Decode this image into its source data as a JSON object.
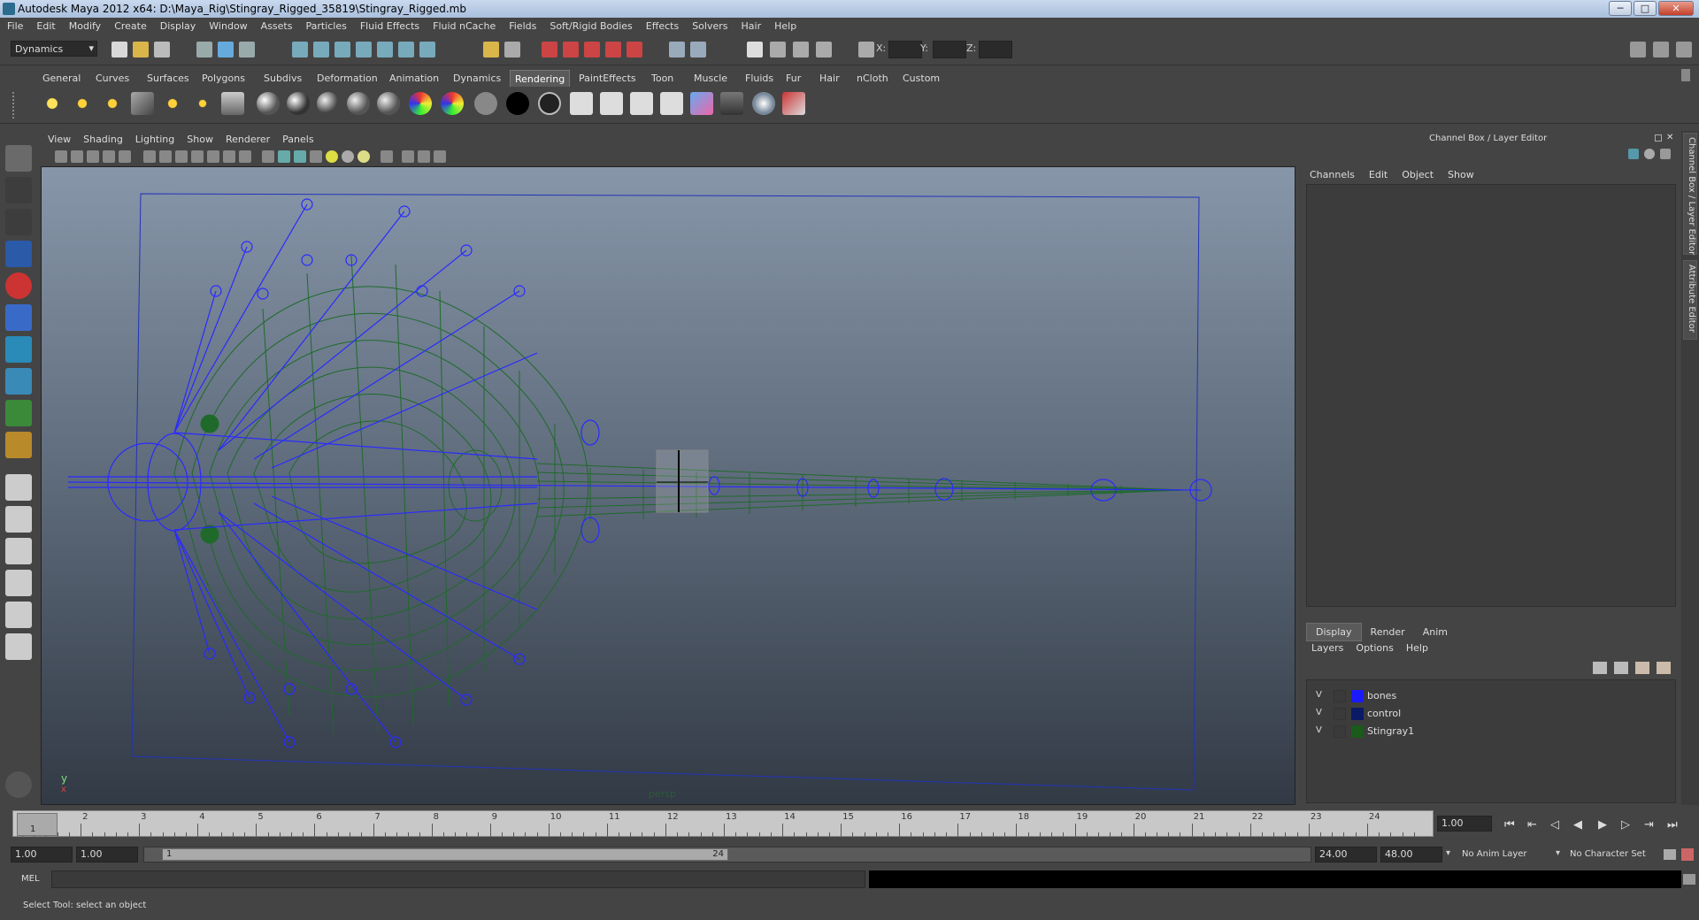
{
  "window": {
    "title": "Autodesk Maya 2012 x64: D:\\Maya_Rig\\Stingray_Rigged_35819\\Stingray_Rigged.mb",
    "min_label": "─",
    "max_label": "□",
    "close_label": "✕"
  },
  "menubar": [
    "File",
    "Edit",
    "Modify",
    "Create",
    "Display",
    "Window",
    "Assets",
    "Particles",
    "Fluid Effects",
    "Fluid nCache",
    "Fields",
    "Soft/Rigid Bodies",
    "Effects",
    "Solvers",
    "Hair",
    "Help"
  ],
  "status_line": {
    "mode": "Dynamics",
    "x_label": "X:",
    "y_label": "Y:",
    "z_label": "Z:"
  },
  "shelf_tabs": [
    "General",
    "Curves",
    "Surfaces",
    "Polygons",
    "Subdivs",
    "Deformation",
    "Animation",
    "Dynamics",
    "Rendering",
    "PaintEffects",
    "Toon",
    "Muscle",
    "Fluids",
    "Fur",
    "Hair",
    "nCloth",
    "Custom"
  ],
  "active_shelf_tab": "Rendering",
  "viewport_menu": [
    "View",
    "Shading",
    "Lighting",
    "Show",
    "Renderer",
    "Panels"
  ],
  "viewport": {
    "camera_label": "persp",
    "axis_y": "y",
    "axis_x": "x"
  },
  "channel_box": {
    "title": "Channel Box / Layer Editor",
    "menu": [
      "Channels",
      "Edit",
      "Object",
      "Show"
    ]
  },
  "layer_editor": {
    "tabs": [
      "Display",
      "Render",
      "Anim"
    ],
    "active_tab": "Display",
    "menu": [
      "Layers",
      "Options",
      "Help"
    ],
    "layers": [
      {
        "visible": "V",
        "name": "bones",
        "color": "#1a1aff"
      },
      {
        "visible": "V",
        "name": "control",
        "color": "#0a1a66"
      },
      {
        "visible": "V",
        "name": "Stingray1",
        "color": "#1a5a1a"
      }
    ]
  },
  "side_tabs": [
    "Channel Box / Layer Editor",
    "Attribute Editor"
  ],
  "time_slider": {
    "ticks": [
      "1",
      "2",
      "3",
      "4",
      "5",
      "6",
      "7",
      "8",
      "9",
      "10",
      "11",
      "12",
      "13",
      "14",
      "15",
      "16",
      "17",
      "18",
      "19",
      "20",
      "21",
      "22",
      "23",
      "24"
    ],
    "current_frame_marker": "1",
    "current_frame": "1.00"
  },
  "range_slider": {
    "start": "1.00",
    "playback_start": "1.00",
    "range_start_label": "1",
    "range_end_label": "24",
    "playback_end": "24.00",
    "end": "48.00",
    "anim_layer": "No Anim Layer",
    "character_set": "No Character Set"
  },
  "command_line": {
    "label": "MEL"
  },
  "help_line": "Select Tool: select an object",
  "colors": {
    "bones": "#2a2aff",
    "mesh": "#1f6a2a",
    "gate": "#2233bb"
  }
}
